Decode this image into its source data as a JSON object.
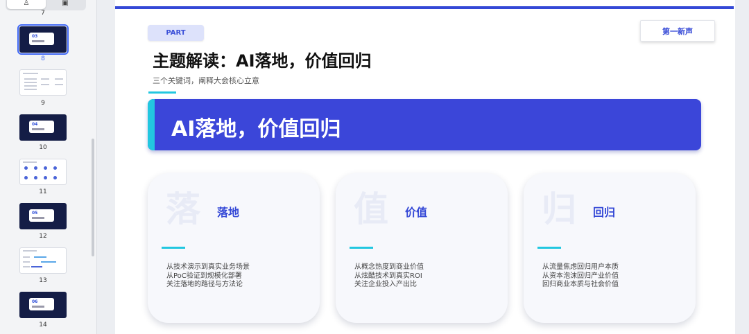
{
  "sidebar": {
    "view_toggle": [
      {
        "name": "outline-view-icon",
        "glyph": "♙"
      },
      {
        "name": "slide-view-icon",
        "glyph": "▣"
      }
    ],
    "top_number": "7",
    "slides": [
      {
        "number": "8",
        "style": "dark",
        "label": "03",
        "selected": true
      },
      {
        "number": "9",
        "style": "light",
        "label": "",
        "selected": false
      },
      {
        "number": "10",
        "style": "dark",
        "label": "04",
        "selected": false
      },
      {
        "number": "11",
        "style": "light",
        "label": "",
        "selected": false
      },
      {
        "number": "12",
        "style": "dark",
        "label": "05",
        "selected": false
      },
      {
        "number": "13",
        "style": "light",
        "label": "",
        "selected": false
      },
      {
        "number": "14",
        "style": "dark",
        "label": "06",
        "selected": false
      }
    ]
  },
  "slide": {
    "part_label": "PART",
    "brand": "第一新声",
    "title": "主题解读：AI落地，价值回归",
    "subtitle": "三个关键词，阐释大会核心立意",
    "banner_text": "AI落地，价值回归",
    "cards": [
      {
        "bg_char": "落",
        "title": "落地",
        "lines": [
          "从技术演示到真实业务场景",
          "从PoC验证到规模化部署",
          "关注落地的路径与方法论"
        ]
      },
      {
        "bg_char": "值",
        "title": "价值",
        "lines": [
          "从概念热度到商业价值",
          "从炫酷技术到真实ROI",
          "关注企业投入产出比"
        ]
      },
      {
        "bg_char": "归",
        "title": "回归",
        "lines": [
          "从流量焦虑回归用户本质",
          "从资本泡沫回归产业价值",
          "回归商业本质与社会价值"
        ]
      }
    ]
  },
  "colors": {
    "accent": "#3448d6",
    "cyan": "#22c7e0",
    "thumb_dark": "#141d46"
  }
}
